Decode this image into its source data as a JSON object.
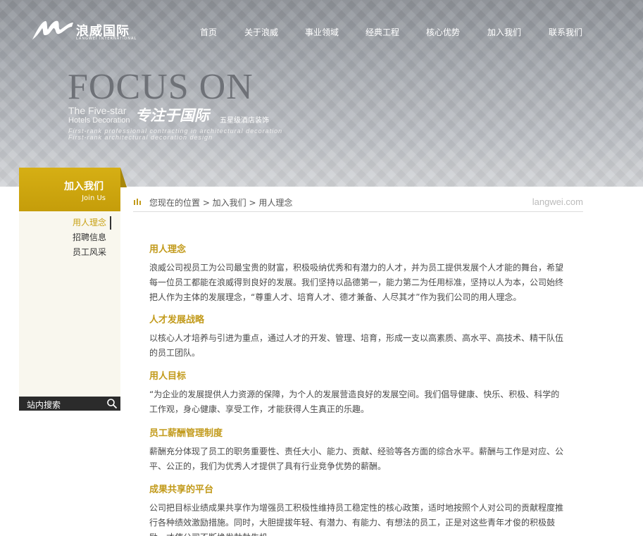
{
  "header": {
    "logo_cn": "浪威国际",
    "logo_en": "LANGWEI INTERNATIONAL",
    "nav": [
      "首页",
      "关于浪威",
      "事业领域",
      "经典工程",
      "核心优势",
      "加入我们",
      "联系我们"
    ]
  },
  "banner": {
    "title": "FOCUS ON",
    "sub1": "The Five-star",
    "sub2": "Hotels Decoration",
    "cn_title": "专注于国际",
    "cn_small": "五星级酒店装饰",
    "line1": "First-rank professional contracting in architectural decoration",
    "line2": "First-rank architectural decoration design"
  },
  "sidebar": {
    "title": "加入我们",
    "subtitle": "Join Us",
    "items": [
      "用人理念",
      "招聘信息",
      "员工风采"
    ],
    "active_index": 0,
    "search_label": "站内搜索"
  },
  "breadcrumb": {
    "text": "您现在的位置 > 加入我们 > 用人理念",
    "domain": "langwei.com"
  },
  "sections": [
    {
      "title": "用人理念",
      "body": "浪威公司视员工为公司最宝贵的财富，积极吸纳优秀和有潜力的人才，并为员工提供发展个人才能的舞台，希望每一位员工都能在浪威得到良好的发展。我们坚持以品德第一，能力第二为任用标准，坚持以人为本，公司始终把人作为主体的发展理念，“尊重人才、培育人才、德才兼备、人尽其才”作为我们公司的用人理念。"
    },
    {
      "title": "人才发展战略",
      "body": "以核心人才培养与引进为重点，通过人才的开发、管理、培育，形成一支以高素质、高水平、高技术、精干队伍的员工团队。"
    },
    {
      "title": "用人目标",
      "body": "“为企业的发展提供人力资源的保障，为个人的发展营造良好的发展空间。我们倡导健康、快乐、积极、科学的工作观，身心健康、享受工作，才能获得人生真正的乐趣。"
    },
    {
      "title": "员工薪酬管理制度",
      "body": "薪酬充分体现了员工的职务重要性、责任大小、能力、贡献、经验等各方面的综合水平。薪酬与工作是对应、公平、公正的，我们为优秀人才提供了具有行业竞争优势的薪酬。"
    },
    {
      "title": "成果共享的平台",
      "body": "公司把目标业绩成果共享作为增强员工积极性维持员工稳定性的核心政策，适时地按照个人对公司的贡献程度推行各种绩效激励措施。同时，大胆提拔年轻、有潜力、有能力、有想法的员工，正是对这些青年才俊的积极鼓励，才使公司不断焕发勃勃生机。"
    }
  ],
  "colors": {
    "accent": "#c29a1a",
    "sidebar_head": "#d6af14",
    "search_bar": "#2b2b2b"
  }
}
